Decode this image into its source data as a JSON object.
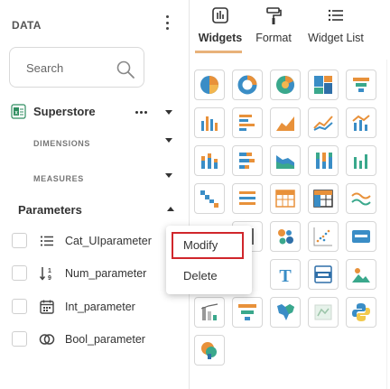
{
  "data_panel": {
    "title": "DATA",
    "search_placeholder": "Search",
    "datasource": "Superstore",
    "sections": {
      "dimensions": "DIMENSIONS",
      "measures": "MEASURES"
    },
    "parameters_title": "Parameters",
    "parameters": [
      {
        "label": "Cat_UIparameter",
        "icon": "list-icon"
      },
      {
        "label": "Num_parameter",
        "icon": "sort-numeric-icon"
      },
      {
        "label": "Int_parameter",
        "icon": "calendar-icon"
      },
      {
        "label": "Bool_parameter",
        "icon": "toggle-circles-icon"
      }
    ]
  },
  "context_menu": {
    "items": [
      {
        "label": "Modify",
        "highlighted": true
      },
      {
        "label": "Delete",
        "highlighted": false
      }
    ]
  },
  "widget_panel": {
    "tabs": [
      {
        "label": "Widgets",
        "icon": "widgets-icon",
        "active": true
      },
      {
        "label": "Format",
        "icon": "paint-roller-icon",
        "active": false
      },
      {
        "label": "Widget List",
        "icon": "list-icon",
        "active": false
      }
    ],
    "widgets": [
      "pie-chart-icon",
      "donut-chart-icon",
      "sunburst-icon",
      "treemap-icon",
      "funnel-icon",
      "column-chart-icon",
      "bar-chart-icon",
      "area-chart-icon",
      "line-chart-icon",
      "combo-chart-icon",
      "stacked-column-icon",
      "stacked-bar-icon",
      "stacked-area-icon",
      "stacked-column-100-icon",
      "stacked-line-icon",
      "waterfall-icon",
      "list-icon",
      "grid-table-icon",
      "pivot-table-icon",
      "spline-icon",
      "bullet-icon",
      "bubble-icon",
      "scatter-icon",
      "card-icon",
      "text-icon",
      "html-icon",
      "image-icon",
      "pareto-icon",
      "gantt-icon",
      "map-icon",
      "image-map-icon",
      "python-icon",
      "r-visual-icon"
    ],
    "accent_color": "#e8b27a"
  },
  "colors": {
    "highlight_border": "#d0262b",
    "widget_orange": "#e8913a",
    "widget_blue": "#3a8dc6",
    "widget_green": "#3aa88c"
  }
}
